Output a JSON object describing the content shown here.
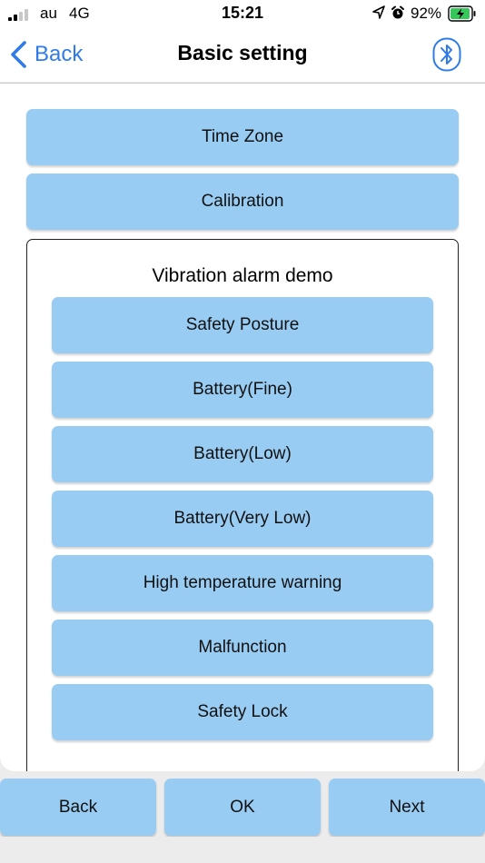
{
  "status_bar": {
    "carrier": "au",
    "network": "4G",
    "time": "15:21",
    "battery_percent": "92%",
    "signal_bars": 2,
    "icons": [
      "location-icon",
      "alarm-icon",
      "battery-charging-icon"
    ]
  },
  "nav": {
    "back_label": "Back",
    "title": "Basic setting",
    "right_icon": "bluetooth-icon"
  },
  "top_buttons": [
    "Time Zone",
    "Calibration"
  ],
  "demo": {
    "title": "Vibration alarm demo",
    "buttons": [
      "Safety Posture",
      "Battery(Fine)",
      "Battery(Low)",
      "Battery(Very Low)",
      "High temperature warning",
      "Malfunction",
      "Safety Lock"
    ]
  },
  "bottom": {
    "back_label": "Back",
    "ok_label": "OK",
    "next_label": "Next"
  },
  "colors": {
    "button_bg": "#99ccf3",
    "accent": "#2f7be8",
    "battery_green": "#35c759"
  }
}
